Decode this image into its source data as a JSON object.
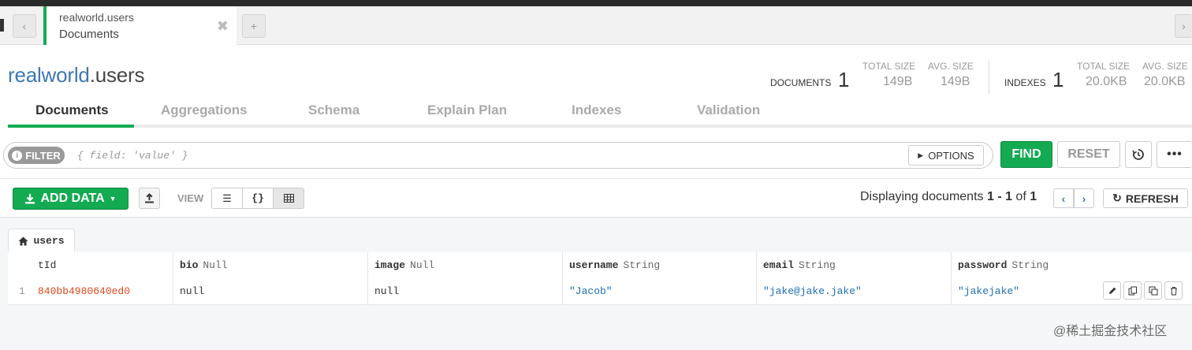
{
  "tab": {
    "title": "realworld.users",
    "subtitle": "Documents",
    "close": "✖",
    "add": "+",
    "back": "‹",
    "forward": "›"
  },
  "header": {
    "db": "realworld",
    "collection": ".users",
    "documents_label": "DOCUMENTS",
    "documents_count": "1",
    "doc_total_size_label": "TOTAL SIZE",
    "doc_total_size": "149B",
    "doc_avg_size_label": "AVG. SIZE",
    "doc_avg_size": "149B",
    "indexes_label": "INDEXES",
    "indexes_count": "1",
    "idx_total_size_label": "TOTAL SIZE",
    "idx_total_size": "20.0KB",
    "idx_avg_size_label": "AVG. SIZE",
    "idx_avg_size": "20.0KB"
  },
  "subtabs": [
    "Documents",
    "Aggregations",
    "Schema",
    "Explain Plan",
    "Indexes",
    "Validation"
  ],
  "query": {
    "filter_label": "FILTER",
    "filter_placeholder": "{ field: 'value' }",
    "options_label": "OPTIONS",
    "find_label": "FIND",
    "reset_label": "RESET"
  },
  "actions": {
    "add_data_label": "ADD DATA",
    "view_label": "VIEW",
    "displaying_prefix": "Displaying documents ",
    "range": "1 - 1",
    "of_text": " of ",
    "total": "1",
    "refresh_label": "REFRESH"
  },
  "collection_tab": "users",
  "table": {
    "columns": [
      {
        "name": "tId",
        "type": ""
      },
      {
        "name": "bio",
        "type": "Null"
      },
      {
        "name": "image",
        "type": "Null"
      },
      {
        "name": "username",
        "type": "String"
      },
      {
        "name": "email",
        "type": "String"
      },
      {
        "name": "password",
        "type": "String"
      }
    ],
    "rows": [
      {
        "index": "1",
        "id": "840bb4980640ed0",
        "bio": "null",
        "image": "null",
        "username": "\"Jacob\"",
        "email": "\"jake@jake.jake\"",
        "password": "\"jakejake\""
      }
    ]
  },
  "watermark": "@稀土掘金技术社区",
  "colors": {
    "accent": "#13aa52",
    "db_name": "#3d78b2",
    "object_id": "#e0481c",
    "string": "#1f6fb2"
  }
}
